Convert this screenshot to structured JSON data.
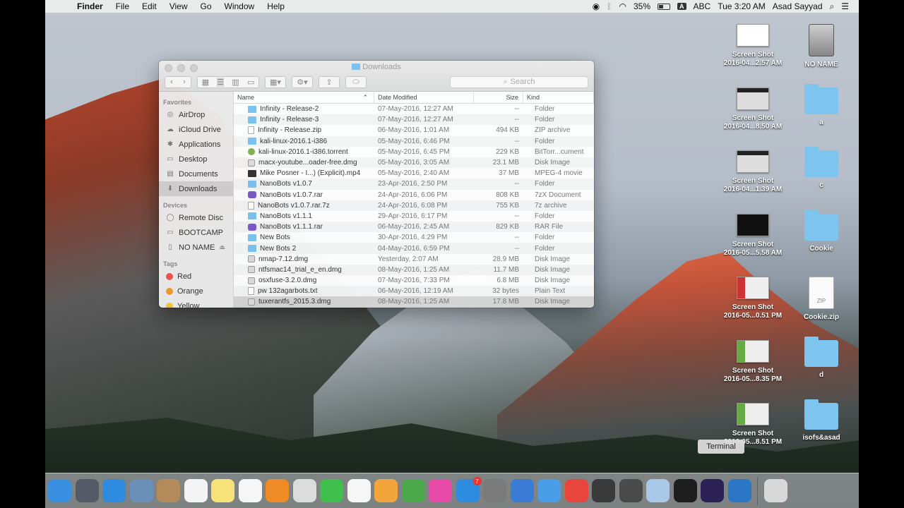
{
  "menubar": {
    "apple": "",
    "items": [
      "Finder",
      "File",
      "Edit",
      "View",
      "Go",
      "Window",
      "Help"
    ],
    "battery": "35%",
    "input": "ABC",
    "clock": "Tue 3:20 AM",
    "user": "Asad Sayyad"
  },
  "window": {
    "title": "Downloads",
    "search_placeholder": "Search"
  },
  "sidebar": {
    "favorites_label": "Favorites",
    "favorites": [
      {
        "label": "AirDrop",
        "icon": "airdrop-icon"
      },
      {
        "label": "iCloud Drive",
        "icon": "cloud-icon"
      },
      {
        "label": "Applications",
        "icon": "applications-icon"
      },
      {
        "label": "Desktop",
        "icon": "desktop-icon"
      },
      {
        "label": "Documents",
        "icon": "documents-icon"
      },
      {
        "label": "Downloads",
        "icon": "downloads-icon"
      }
    ],
    "devices_label": "Devices",
    "devices": [
      {
        "label": "Remote Disc",
        "icon": "disc-icon"
      },
      {
        "label": "BOOTCAMP",
        "icon": "drive-icon"
      },
      {
        "label": "NO NAME",
        "icon": "drive-icon",
        "eject": "⏏"
      }
    ],
    "tags_label": "Tags",
    "tags": [
      {
        "label": "Red",
        "color": "#f0524f"
      },
      {
        "label": "Orange",
        "color": "#f39a2d"
      },
      {
        "label": "Yellow",
        "color": "#f5c92f"
      }
    ]
  },
  "columns": {
    "name": "Name",
    "date": "Date Modified",
    "size": "Size",
    "kind": "Kind"
  },
  "files": [
    {
      "name": "Infinity - Release-2",
      "date": "07-May-2016, 12:27 AM",
      "size": "--",
      "kind": "Folder",
      "type": "folder"
    },
    {
      "name": "Infinity - Release-3",
      "date": "07-May-2016, 12:27 AM",
      "size": "--",
      "kind": "Folder",
      "type": "folder"
    },
    {
      "name": "Infinity - Release.zip",
      "date": "06-May-2016, 1:01 AM",
      "size": "494 KB",
      "kind": "ZIP archive",
      "type": "doc"
    },
    {
      "name": "kali-linux-2016.1-i386",
      "date": "05-May-2016, 6:46 PM",
      "size": "--",
      "kind": "Folder",
      "type": "folder"
    },
    {
      "name": "kali-linux-2016.1-i386.torrent",
      "date": "05-May-2016, 6:45 PM",
      "size": "229 KB",
      "kind": "BitTorr...cument",
      "type": "torrent"
    },
    {
      "name": "macx-youtube...oader-free.dmg",
      "date": "05-May-2016, 3:05 AM",
      "size": "23.1 MB",
      "kind": "Disk Image",
      "type": "dmg"
    },
    {
      "name": "Mike Posner - I...) (Explicit).mp4",
      "date": "05-May-2016, 2:40 AM",
      "size": "37 MB",
      "kind": "MPEG-4 movie",
      "type": "movie"
    },
    {
      "name": "NanoBots v1.0.7",
      "date": "23-Apr-2016, 2:50 PM",
      "size": "--",
      "kind": "Folder",
      "type": "folder"
    },
    {
      "name": "NanoBots v1.0.7.rar",
      "date": "24-Apr-2016, 6:06 PM",
      "size": "808 KB",
      "kind": "7zX Document",
      "type": "rar"
    },
    {
      "name": "NanoBots v1.0.7.rar.7z",
      "date": "24-Apr-2016, 6:08 PM",
      "size": "755 KB",
      "kind": "7z archive",
      "type": "doc"
    },
    {
      "name": "NanoBots v1.1.1",
      "date": "29-Apr-2016, 6:17 PM",
      "size": "--",
      "kind": "Folder",
      "type": "folder"
    },
    {
      "name": "NanoBots v1.1.1.rar",
      "date": "06-May-2016, 2:45 AM",
      "size": "829 KB",
      "kind": "RAR File",
      "type": "rar"
    },
    {
      "name": "New Bots",
      "date": "30-Apr-2016, 4:29 PM",
      "size": "--",
      "kind": "Folder",
      "type": "folder"
    },
    {
      "name": "New Bots 2",
      "date": "04-May-2016, 6:59 PM",
      "size": "--",
      "kind": "Folder",
      "type": "folder"
    },
    {
      "name": "nmap-7.12.dmg",
      "date": "Yesterday, 2:07 AM",
      "size": "28.9 MB",
      "kind": "Disk Image",
      "type": "dmg"
    },
    {
      "name": "ntfsmac14_trial_e_en.dmg",
      "date": "08-May-2016, 1:25 AM",
      "size": "11.7 MB",
      "kind": "Disk Image",
      "type": "dmg"
    },
    {
      "name": "osxfuse-3.2.0.dmg",
      "date": "07-May-2016, 7:33 PM",
      "size": "6.8 MB",
      "kind": "Disk Image",
      "type": "dmg"
    },
    {
      "name": "pw 132agarbots.txt",
      "date": "06-May-2016, 12:19 AM",
      "size": "32 bytes",
      "kind": "Plain Text",
      "type": "doc"
    },
    {
      "name": "tuxerantfs_2015.3.dmg",
      "date": "08-May-2016, 1:25 AM",
      "size": "17.8 MB",
      "kind": "Disk Image",
      "type": "dmg"
    }
  ],
  "desktop_icons": [
    {
      "label1": "Screen Shot",
      "label2": "2016-04...2.57 AM",
      "kind": "screenshot-white"
    },
    {
      "label1": "NO NAME",
      "label2": "",
      "kind": "sd-card"
    },
    {
      "label1": "Screen Shot",
      "label2": "2016-04...8.50 AM",
      "kind": "screenshot-dark"
    },
    {
      "label1": "a",
      "label2": "",
      "kind": "folder"
    },
    {
      "label1": "Screen Shot",
      "label2": "2016-04...1.39 AM",
      "kind": "screenshot-dark"
    },
    {
      "label1": "c",
      "label2": "",
      "kind": "folder"
    },
    {
      "label1": "Screen Shot",
      "label2": "2016-05...5.58 AM",
      "kind": "screenshot-black"
    },
    {
      "label1": "Cookie",
      "label2": "",
      "kind": "folder"
    },
    {
      "label1": "Screen Shot",
      "label2": "2016-05...0.51 PM",
      "kind": "screenshot-red"
    },
    {
      "label1": "Cookie.zip",
      "label2": "",
      "kind": "zip"
    },
    {
      "label1": "Screen Shot",
      "label2": "2016-05...8.35 PM",
      "kind": "screenshot-green"
    },
    {
      "label1": "d",
      "label2": "",
      "kind": "folder"
    },
    {
      "label1": "Screen Shot",
      "label2": "2016-05...8.51 PM",
      "kind": "screenshot-green"
    },
    {
      "label1": "isofs&asad",
      "label2": "",
      "kind": "folder"
    }
  ],
  "tooltip": "Terminal",
  "zip_label": "ZIP",
  "dock": [
    {
      "name": "finder",
      "color": "#3b8fe0"
    },
    {
      "name": "launchpad",
      "color": "#555b66"
    },
    {
      "name": "safari",
      "color": "#2d8be0"
    },
    {
      "name": "preview",
      "color": "#6a8fb8"
    },
    {
      "name": "contacts",
      "color": "#b58a5a"
    },
    {
      "name": "calendar",
      "color": "#f4f4f4"
    },
    {
      "name": "notes",
      "color": "#f7e27a"
    },
    {
      "name": "reminders",
      "color": "#f6f6f6"
    },
    {
      "name": "ibooks",
      "color": "#f08a24"
    },
    {
      "name": "photo-booth",
      "color": "#dcdcdc"
    },
    {
      "name": "facetime",
      "color": "#3fbf4e"
    },
    {
      "name": "photos",
      "color": "#f6f6f6"
    },
    {
      "name": "pages",
      "color": "#f2a53a"
    },
    {
      "name": "numbers",
      "color": "#4aa84a"
    },
    {
      "name": "itunes",
      "color": "#e84aa8"
    },
    {
      "name": "app-store",
      "color": "#2d8be0",
      "badge": "7"
    },
    {
      "name": "system-preferences",
      "color": "#7a7a7a"
    },
    {
      "name": "keynote",
      "color": "#3a7bd5"
    },
    {
      "name": "messages",
      "color": "#4a9ee8"
    },
    {
      "name": "chrome",
      "color": "#e8453c"
    },
    {
      "name": "hand-tool",
      "color": "#3a3a3a"
    },
    {
      "name": "sublime-text",
      "color": "#4a4a4a"
    },
    {
      "name": "virtualbox",
      "color": "#a9c8e8"
    },
    {
      "name": "terminal",
      "color": "#1e1e1e"
    },
    {
      "name": "eclipse",
      "color": "#2c2255"
    },
    {
      "name": "quicktime",
      "color": "#2c76c6"
    },
    {
      "name": "trash",
      "color": "#d8d8d8"
    }
  ]
}
